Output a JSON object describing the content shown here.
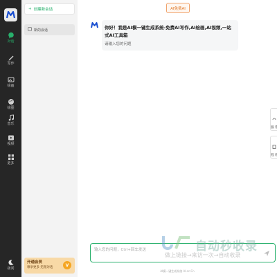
{
  "rail": {
    "items": [
      {
        "label": "对话",
        "icon": "chat-icon",
        "active": true
      },
      {
        "label": "写作",
        "icon": "pen-icon",
        "active": false
      },
      {
        "label": "绘画",
        "icon": "image-icon",
        "active": false
      },
      {
        "label": "绘图",
        "icon": "palette-icon",
        "active": false
      },
      {
        "label": "音乐",
        "icon": "music-icon",
        "active": false
      },
      {
        "label": "视频",
        "icon": "video-icon",
        "active": false
      },
      {
        "label": "更多",
        "icon": "apps-icon",
        "active": false
      }
    ],
    "theme_label": "夜间"
  },
  "panel": {
    "new_chat_label": "创建新会话",
    "conversations": [
      "新的会话"
    ],
    "vip": {
      "title": "开通会员",
      "subtitle": "尊享更多 无限对话",
      "badge": "V"
    }
  },
  "main": {
    "free_badge": "AI免费AI",
    "bot_message": {
      "title": "你好！我是AI模一键生成系统-免费AI写作,AI绘画,AI视频,一站式AI工具箱",
      "subtitle": "请输入您的问题"
    },
    "side_tabs": [
      "客服",
      "教程"
    ],
    "input": {
      "placeholder": "输入您的问题，Ctrl+回车发送",
      "value": ""
    },
    "footer": "AI模一键生成系统 AI.cc.Cn"
  },
  "watermark": {
    "main": "自动秒收录",
    "sub": "做上链接→来访一次→自动收录"
  },
  "colors": {
    "accent": "#28b06c",
    "rail_bg": "#262626",
    "panel_bg": "#f3f3f3",
    "vip_bg": "#f8d9a6",
    "badge": "#e07a2b"
  }
}
